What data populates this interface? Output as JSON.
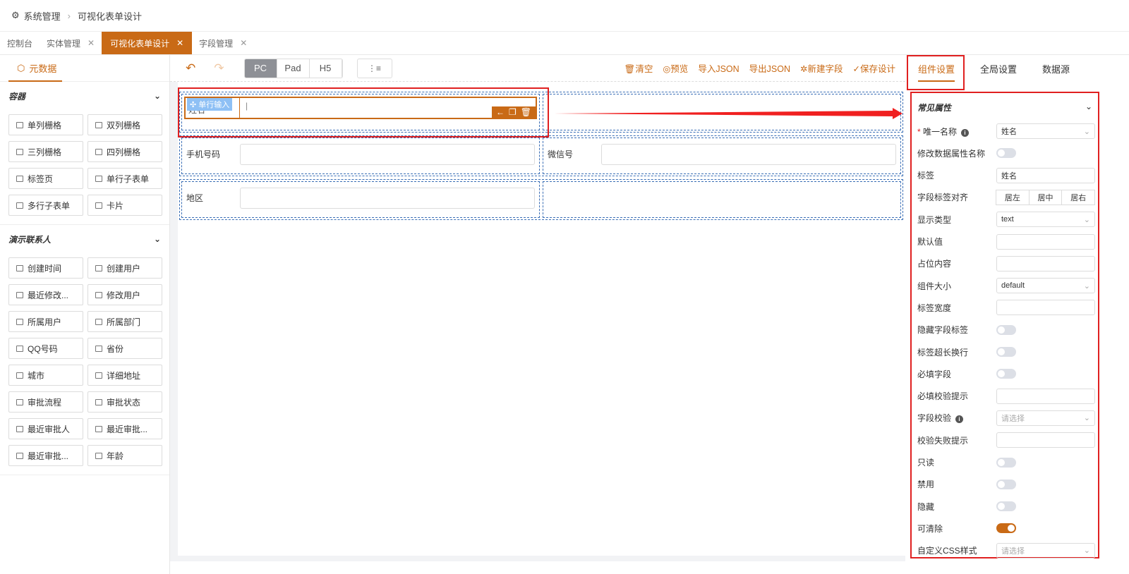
{
  "accent": "#c96a16",
  "breadcrumb": {
    "root": "系统管理",
    "current": "可视化表单设计"
  },
  "tabs": [
    {
      "label": "控制台",
      "closable": false
    },
    {
      "label": "实体管理",
      "closable": true
    },
    {
      "label": "可视化表单设计",
      "closable": true,
      "active": true
    },
    {
      "label": "字段管理",
      "closable": true
    }
  ],
  "left": {
    "title": "元数据",
    "groups": [
      {
        "title": "容器",
        "items": [
          "单列栅格",
          "双列栅格",
          "三列栅格",
          "四列栅格",
          "标签页",
          "单行子表单",
          "多行子表单",
          "卡片"
        ]
      },
      {
        "title": "演示联系人",
        "items": [
          "创建时间",
          "创建用户",
          "最近修改...",
          "修改用户",
          "所属用户",
          "所属部门",
          "QQ号码",
          "省份",
          "城市",
          "详细地址",
          "审批流程",
          "审批状态",
          "最近审批人",
          "最近审批...",
          "最近审批...",
          "年龄"
        ]
      }
    ]
  },
  "toolbar": {
    "devices": [
      "PC",
      "Pad",
      "H5"
    ],
    "active_device": "PC",
    "actions": [
      "清空",
      "预览",
      "导入JSON",
      "导出JSON",
      "新建字段",
      "保存设计"
    ]
  },
  "canvas": {
    "selected_badge": "单行输入",
    "rows": [
      [
        {
          "label": "姓名"
        },
        {
          "label": ""
        }
      ],
      [
        {
          "label": "手机号码"
        },
        {
          "label": "微信号"
        }
      ],
      [
        {
          "label": "地区"
        },
        {
          "label": ""
        }
      ]
    ]
  },
  "right": {
    "tabs": [
      "组件设置",
      "全局设置",
      "数据源"
    ],
    "active_tab": "组件设置",
    "section": "常见属性",
    "props": [
      {
        "label": "唯一名称",
        "type": "select",
        "value": "姓名",
        "required": true,
        "info": true
      },
      {
        "label": "修改数据属性名称",
        "type": "switch",
        "on": false
      },
      {
        "label": "标签",
        "type": "input",
        "value": "姓名"
      },
      {
        "label": "字段标签对齐",
        "type": "radio",
        "options": [
          "居左",
          "居中",
          "居右"
        ]
      },
      {
        "label": "显示类型",
        "type": "select",
        "value": "text"
      },
      {
        "label": "默认值",
        "type": "input",
        "value": ""
      },
      {
        "label": "占位内容",
        "type": "input",
        "value": ""
      },
      {
        "label": "组件大小",
        "type": "select",
        "value": "default"
      },
      {
        "label": "标签宽度",
        "type": "input",
        "value": ""
      },
      {
        "label": "隐藏字段标签",
        "type": "switch",
        "on": false
      },
      {
        "label": "标签超长换行",
        "type": "switch",
        "on": false
      },
      {
        "label": "必填字段",
        "type": "switch",
        "on": false
      },
      {
        "label": "必填校验提示",
        "type": "input",
        "value": ""
      },
      {
        "label": "字段校验",
        "type": "select",
        "value": "",
        "placeholder": "请选择",
        "info": true
      },
      {
        "label": "校验失败提示",
        "type": "input",
        "value": ""
      },
      {
        "label": "只读",
        "type": "switch",
        "on": false
      },
      {
        "label": "禁用",
        "type": "switch",
        "on": false
      },
      {
        "label": "隐藏",
        "type": "switch",
        "on": false
      },
      {
        "label": "可清除",
        "type": "switch",
        "on": true
      },
      {
        "label": "自定义CSS样式",
        "type": "select",
        "value": "",
        "placeholder": "请选择"
      }
    ]
  }
}
